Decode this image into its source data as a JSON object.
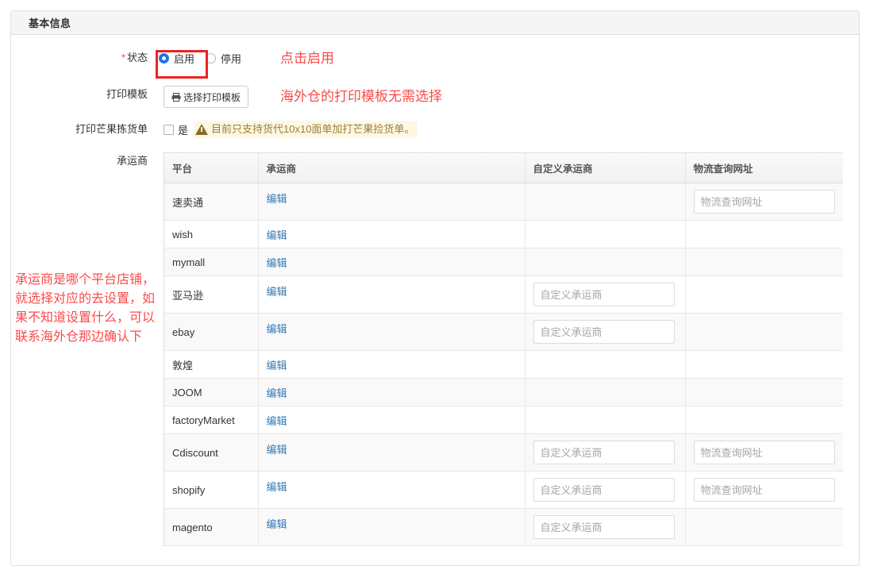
{
  "panel": {
    "title": "基本信息"
  },
  "form": {
    "status": {
      "label": "状态",
      "required_mark": "*",
      "options": [
        {
          "label": "启用",
          "checked": true
        },
        {
          "label": "停用",
          "checked": false
        }
      ]
    },
    "print_template": {
      "label": "打印模板",
      "button_label": "选择打印模板",
      "button_icon": "printer-icon"
    },
    "mango_pick": {
      "label": "打印芒果拣货单",
      "checkbox_label": "是",
      "checked": false,
      "warning_icon": "warning-triangle-icon",
      "warning_text": "目前只支持货代10x10面单加打芒果捡货单。"
    },
    "carrier": {
      "label": "承运商"
    }
  },
  "annotations": {
    "click_enable": "点击启用",
    "print_template": "海外仓的打印模板无需选择",
    "carrier_note": "承运商是哪个平台店铺，就选择对应的去设置，如果不知道设置什么，可以联系海外仓那边确认下",
    "color": "#fb4a4a",
    "highlight_color": "#ee2222"
  },
  "table": {
    "columns": [
      "平台",
      "承运商",
      "自定义承运商",
      "物流查询网址"
    ],
    "edit_label": "编辑",
    "placeholders": {
      "custom_carrier": "自定义承运商",
      "logistics_url": "物流查询网址"
    },
    "rows": [
      {
        "platform": "速卖通",
        "edit": "编辑",
        "custom_carrier": null,
        "logistics_url": "物流查询网址"
      },
      {
        "platform": "wish",
        "edit": "编辑",
        "custom_carrier": null,
        "logistics_url": null
      },
      {
        "platform": "mymall",
        "edit": "编辑",
        "custom_carrier": null,
        "logistics_url": null
      },
      {
        "platform": "亚马逊",
        "edit": "编辑",
        "custom_carrier": "自定义承运商",
        "logistics_url": null
      },
      {
        "platform": "ebay",
        "edit": "编辑",
        "custom_carrier": "自定义承运商",
        "logistics_url": null
      },
      {
        "platform": "敦煌",
        "edit": "编辑",
        "custom_carrier": null,
        "logistics_url": null
      },
      {
        "platform": "JOOM",
        "edit": "编辑",
        "custom_carrier": null,
        "logistics_url": null
      },
      {
        "platform": "factoryMarket",
        "edit": "编辑",
        "custom_carrier": null,
        "logistics_url": null
      },
      {
        "platform": "Cdiscount",
        "edit": "编辑",
        "custom_carrier": "自定义承运商",
        "logistics_url": "物流查询网址"
      },
      {
        "platform": "shopify",
        "edit": "编辑",
        "custom_carrier": "自定义承运商",
        "logistics_url": "物流查询网址"
      },
      {
        "platform": "magento",
        "edit": "编辑",
        "custom_carrier": "自定义承运商",
        "logistics_url": null
      }
    ]
  }
}
